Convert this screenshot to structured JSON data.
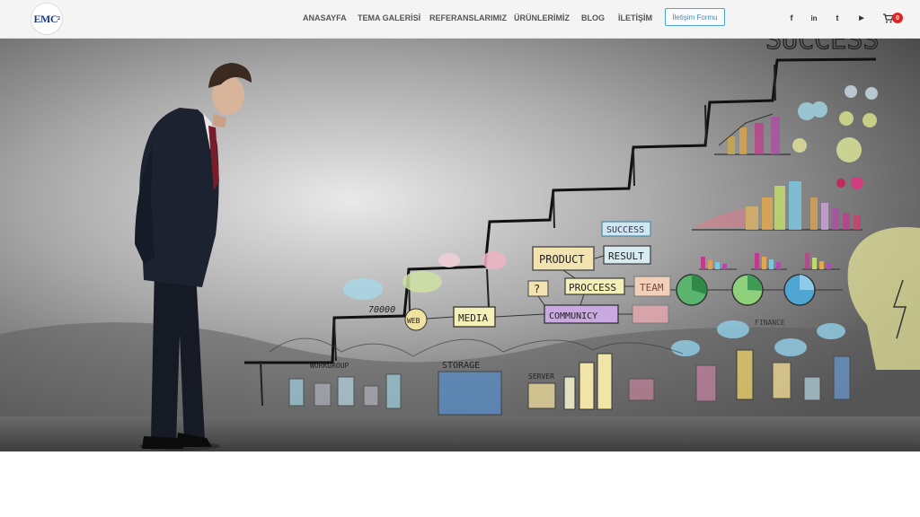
{
  "brand": {
    "logo_text": "EMC",
    "logo_sup": "2"
  },
  "nav": {
    "items": [
      {
        "label": "ANASAYFA"
      },
      {
        "label": "TEMA GALERİSİ"
      },
      {
        "label": "REFERANSLARIMIZ"
      },
      {
        "label": "ÜRÜNLERİMİZ"
      },
      {
        "label": "BLOG"
      },
      {
        "label": "İLETİŞİM"
      }
    ],
    "form_button": "İletişim Formu"
  },
  "social": {
    "icons": [
      "facebook-icon",
      "linkedin-icon",
      "twitter-icon",
      "youtube-icon"
    ],
    "glyphs": [
      "f",
      "in",
      "t",
      "▶"
    ]
  },
  "cart": {
    "count": "0",
    "icon": "shopping-cart-icon"
  },
  "hero": {
    "wall_texts": {
      "success_top": "SUCCESS",
      "success_box": "SUCCESS",
      "product": "PRODUCT",
      "result": "RESULT",
      "process": "PROCCESS",
      "team": "TEAM",
      "media": "MEDIA",
      "community": "COMMUNICY",
      "web": "WEB",
      "storage": "STORAGE",
      "server": "SERVER",
      "group": "WORKGROUP",
      "finance": "FINANCE",
      "number": "70000",
      "question": "?"
    },
    "colors": {
      "wall": "#8c8c8c",
      "floor": "#555555",
      "suit": "#1c2230"
    }
  }
}
